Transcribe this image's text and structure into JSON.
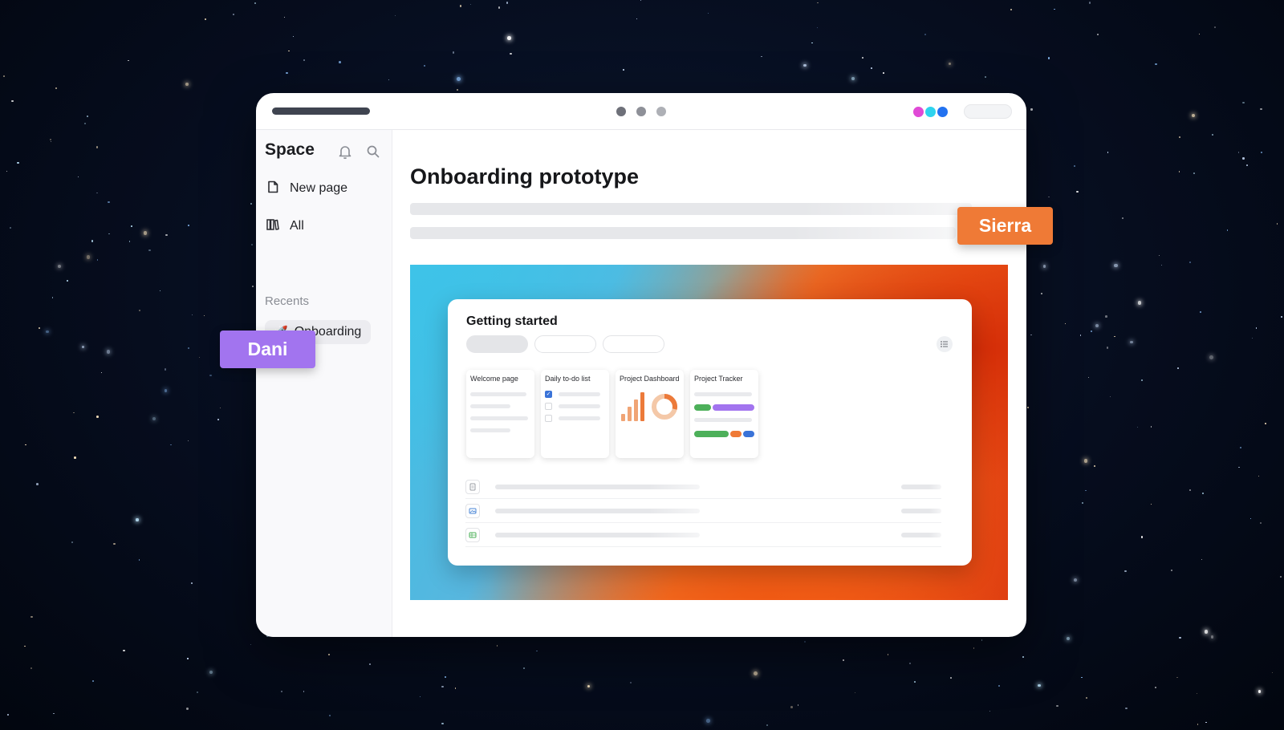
{
  "window": {
    "dot_colors": [
      "#6e7079",
      "#8e9098",
      "#aeb0b6"
    ],
    "avatar_colors": [
      "#e04ad6",
      "#2ed3ee",
      "#2272f0"
    ]
  },
  "sidebar": {
    "title": "Space",
    "icons": {
      "notifications": "bell-icon",
      "search": "search-icon"
    },
    "items": [
      {
        "label": "New page",
        "icon": "page-icon"
      },
      {
        "label": "All",
        "icon": "library-icon"
      }
    ],
    "recents_label": "Recents",
    "recents": [
      {
        "label": "Onboarding",
        "emoji": "🚀"
      }
    ]
  },
  "main": {
    "title": "Onboarding prototype",
    "banner": {
      "card_title": "Getting started",
      "templates": [
        {
          "title": "Welcome page"
        },
        {
          "title": "Daily to-do list"
        },
        {
          "title": "Project Dashboard"
        },
        {
          "title": "Project Tracker"
        }
      ],
      "row_icons": [
        "doc-icon",
        "image-icon",
        "table-icon"
      ]
    }
  },
  "collaborators": [
    {
      "name": "Dani",
      "color": "#a274ef"
    },
    {
      "name": "Sierra",
      "color": "#ef7a36"
    }
  ]
}
